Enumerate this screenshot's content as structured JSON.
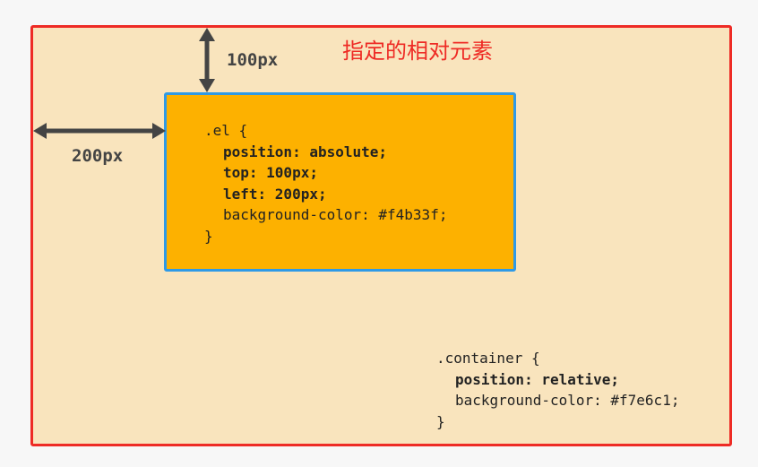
{
  "colors": {
    "container_bg": "#f9e4bd",
    "container_border": "#ee2b25",
    "el_bg": "#fdb100",
    "el_border": "#2f9ae7",
    "arrow": "#444444",
    "title": "#ee2b25"
  },
  "container_title": "指定的相对元素",
  "dimensions": {
    "top_label": "100px",
    "left_label": "200px"
  },
  "el_code": {
    "selector": ".el {",
    "lines": [
      "position: absolute;",
      "top: 100px;",
      "left: 200px;",
      "background-color: #f4b33f;"
    ],
    "close": "}"
  },
  "container_code": {
    "selector": ".container {",
    "lines": [
      "position: relative;",
      "background-color: #f7e6c1;"
    ],
    "close": "}"
  }
}
